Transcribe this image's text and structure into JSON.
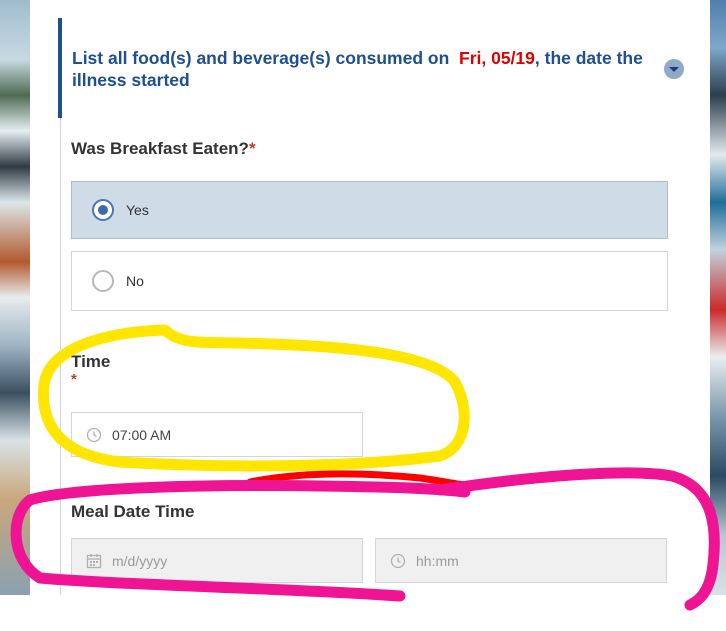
{
  "section": {
    "heading_before": "List all food(s) and beverage(s) consumed on",
    "heading_date": "Fri, 05/19",
    "heading_after": ", the date the illness started"
  },
  "breakfast": {
    "label": "Was Breakfast Eaten?",
    "required_mark": "*",
    "options": [
      {
        "label": "Yes",
        "selected": true
      },
      {
        "label": "No",
        "selected": false
      }
    ]
  },
  "time": {
    "label": "Time",
    "required_mark": "*",
    "value": "07:00 AM"
  },
  "meal_date_time": {
    "label": "Meal Date Time",
    "date_placeholder": "m/d/yyyy",
    "time_placeholder": "hh:mm"
  },
  "colors": {
    "heading": "#1d4f91",
    "heading_date": "#e00000",
    "highlight_yellow": "#ffe600",
    "highlight_magenta": "#ee1493",
    "highlight_red": "#ff0000"
  }
}
